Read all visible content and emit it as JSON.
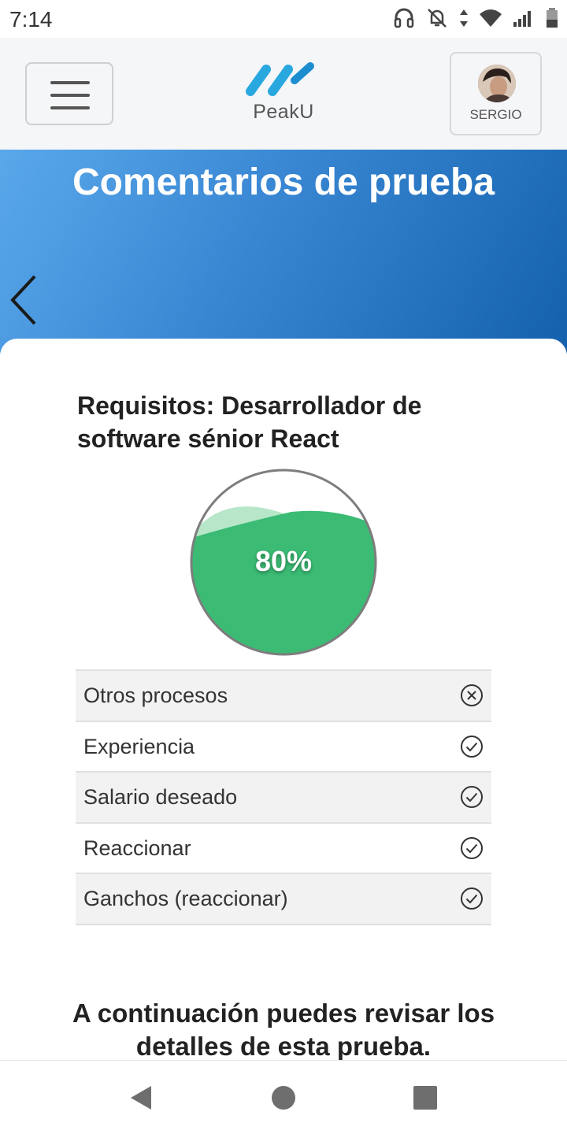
{
  "status_bar": {
    "time": "7:14",
    "icons": [
      "headphones-icon",
      "notifications-off-icon",
      "data-arrows-icon",
      "wifi-icon",
      "signal-icon",
      "battery-icon"
    ]
  },
  "header": {
    "logo_text": "PeakU",
    "user_name": "SERGIO",
    "accent": "#29a8e0"
  },
  "hero": {
    "title": "Comentarios de prueba"
  },
  "card": {
    "requirements_title": "Requisitos: Desarrollador de software sénior React",
    "score_label": "80%",
    "score_value": 80,
    "score_color": "#3bbb74",
    "items": [
      {
        "label": "Otros procesos",
        "status": "fail"
      },
      {
        "label": "Experiencia",
        "status": "pass"
      },
      {
        "label": "Salario deseado",
        "status": "pass"
      },
      {
        "label": "Reaccionar",
        "status": "pass"
      },
      {
        "label": "Ganchos (reaccionar)",
        "status": "pass"
      }
    ],
    "details_text": "A continuación puedes revisar los detalles de esta prueba."
  }
}
